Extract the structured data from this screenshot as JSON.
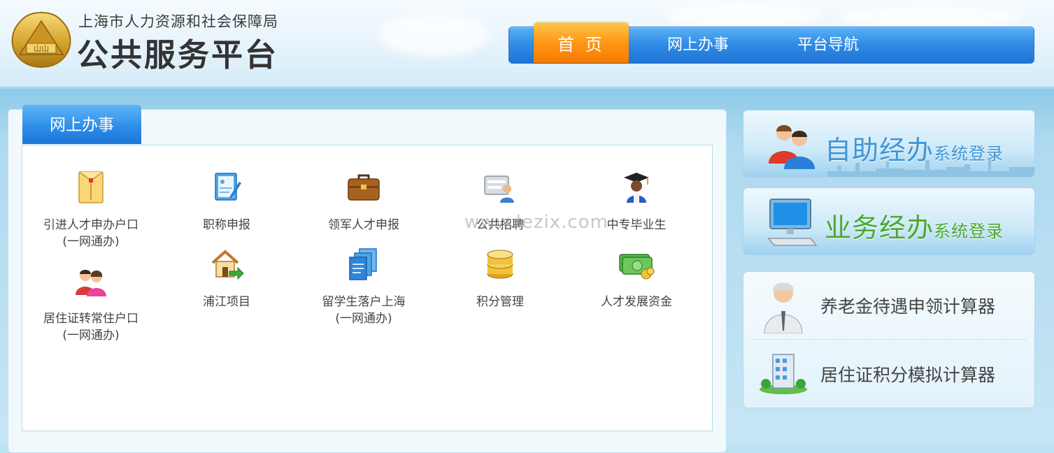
{
  "header": {
    "org_name": "上海市人力资源和社会保障局",
    "platform_name": "公共服务平台",
    "logo_icon": "emblem-icon"
  },
  "nav": {
    "items": [
      {
        "label": "首 页",
        "active": true
      },
      {
        "label": "网上办事",
        "active": false
      },
      {
        "label": "平台导航",
        "active": false
      }
    ]
  },
  "main": {
    "tab_label": "网上办事",
    "services": [
      {
        "label": "引进人才申办户口",
        "sub": "(一网通办)",
        "icon": "envelope-icon"
      },
      {
        "label": "职称申报",
        "sub": "",
        "icon": "certificate-icon"
      },
      {
        "label": "领军人才申报",
        "sub": "",
        "icon": "briefcase-icon"
      },
      {
        "label": "公共招聘",
        "sub": "",
        "icon": "recruit-icon"
      },
      {
        "label": "中专毕业生",
        "sub": "",
        "icon": "graduate-icon"
      },
      {
        "label": "居住证转常住户口",
        "sub": "(一网通办)",
        "icon": "couple-icon"
      },
      {
        "label": "浦江项目",
        "sub": "",
        "icon": "house-icon"
      },
      {
        "label": "留学生落户上海",
        "sub": "(一网通办)",
        "icon": "documents-icon"
      },
      {
        "label": "积分管理",
        "sub": "",
        "icon": "coins-icon"
      },
      {
        "label": "人才发展资金",
        "sub": "",
        "icon": "money-icon"
      }
    ],
    "watermark": "www.lezix.com"
  },
  "sidebar": {
    "banner_self": {
      "big": "自助经办",
      "small": "系统登录"
    },
    "banner_business": {
      "big": "业务经办",
      "small": "系统登录"
    },
    "calculators": [
      {
        "label": "养老金待遇申领计算器",
        "icon": "elder-person-icon"
      },
      {
        "label": "居住证积分模拟计算器",
        "icon": "building-icon"
      }
    ]
  },
  "colors": {
    "nav_blue": "#2f8ae6",
    "nav_active_orange": "#ff9a1a",
    "self_service_blue": "#3f95d6",
    "business_green": "#4aa832"
  }
}
